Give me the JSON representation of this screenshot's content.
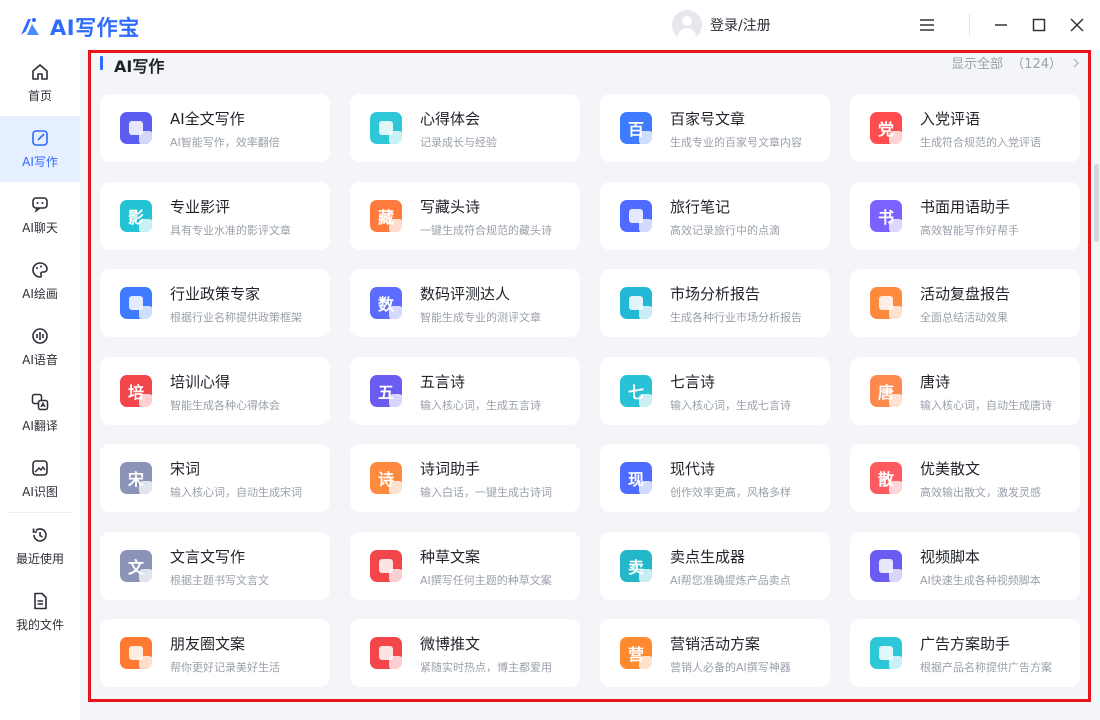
{
  "app": {
    "title": "AI写作宝"
  },
  "header": {
    "login_label": "登录/注册"
  },
  "sidebar": {
    "items": [
      {
        "label": "首页",
        "icon": "home-icon"
      },
      {
        "label": "AI写作",
        "icon": "edit-icon"
      },
      {
        "label": "AI聊天",
        "icon": "chat-icon"
      },
      {
        "label": "AI绘画",
        "icon": "palette-icon"
      },
      {
        "label": "AI语音",
        "icon": "voice-icon"
      },
      {
        "label": "AI翻译",
        "icon": "translate-icon"
      },
      {
        "label": "AI识图",
        "icon": "image-icon"
      },
      {
        "label": "最近使用",
        "icon": "history-icon"
      },
      {
        "label": "我的文件",
        "icon": "file-icon"
      }
    ]
  },
  "section": {
    "title": "AI写作",
    "show_all": "显示全部",
    "count": "（124）"
  },
  "cards": [
    {
      "title": "AI全文写作",
      "desc": "AI智能写作，效率翻倍",
      "color": "#5b5cf0",
      "glyph": ""
    },
    {
      "title": "心得体会",
      "desc": "记录成长与经验",
      "color": "#2ec7d8",
      "glyph": ""
    },
    {
      "title": "百家号文章",
      "desc": "生成专业的百家号文章内容",
      "color": "#3f7bff",
      "glyph": "百"
    },
    {
      "title": "入党评语",
      "desc": "生成符合规范的入党评语",
      "color": "#ff4d4f",
      "glyph": "党"
    },
    {
      "title": "专业影评",
      "desc": "具有专业水准的影评文章",
      "color": "#24c3d5",
      "glyph": "影"
    },
    {
      "title": "写藏头诗",
      "desc": "一键生成符合规范的藏头诗",
      "color": "#ff7a3d",
      "glyph": "藏"
    },
    {
      "title": "旅行笔记",
      "desc": "高效记录旅行中的点滴",
      "color": "#4f6bff",
      "glyph": ""
    },
    {
      "title": "书面用语助手",
      "desc": "高效智能写作好帮手",
      "color": "#7b61ff",
      "glyph": "书"
    },
    {
      "title": "行业政策专家",
      "desc": "根据行业名称提供政策框架",
      "color": "#3f7bff",
      "glyph": ""
    },
    {
      "title": "数码评测达人",
      "desc": "智能生成专业的测评文章",
      "color": "#5b6cff",
      "glyph": "数"
    },
    {
      "title": "市场分析报告",
      "desc": "生成各种行业市场分析报告",
      "color": "#22b8d6",
      "glyph": ""
    },
    {
      "title": "活动复盘报告",
      "desc": "全面总结活动效果",
      "color": "#ff8a3d",
      "glyph": ""
    },
    {
      "title": "培训心得",
      "desc": "智能生成各种心得体会",
      "color": "#f2464b",
      "glyph": "培"
    },
    {
      "title": "五言诗",
      "desc": "输入核心词，生成五言诗",
      "color": "#6a5cf0",
      "glyph": "五"
    },
    {
      "title": "七言诗",
      "desc": "输入核心词，生成七言诗",
      "color": "#28c1d6",
      "glyph": "七"
    },
    {
      "title": "唐诗",
      "desc": "输入核心词，自动生成唐诗",
      "color": "#ff8a50",
      "glyph": "唐"
    },
    {
      "title": "宋词",
      "desc": "输入核心词，自动生成宋词",
      "color": "#8b93b8",
      "glyph": "宋"
    },
    {
      "title": "诗词助手",
      "desc": "输入白话，一键生成古诗词",
      "color": "#ff8a3d",
      "glyph": "诗"
    },
    {
      "title": "现代诗",
      "desc": "创作效率更高，风格多样",
      "color": "#4f6bff",
      "glyph": "现"
    },
    {
      "title": "优美散文",
      "desc": "高效输出散文，激发灵感",
      "color": "#ff5a5f",
      "glyph": "散"
    },
    {
      "title": "文言文写作",
      "desc": "根据主题书写文言文",
      "color": "#8b93b8",
      "glyph": "文"
    },
    {
      "title": "种草文案",
      "desc": "AI撰写任何主题的种草文案",
      "color": "#f2464b",
      "glyph": ""
    },
    {
      "title": "卖点生成器",
      "desc": "AI帮您准确提炼产品卖点",
      "color": "#22b8c9",
      "glyph": "卖"
    },
    {
      "title": "视频脚本",
      "desc": "AI快速生成各种视频脚本",
      "color": "#6a5cf0",
      "glyph": ""
    },
    {
      "title": "朋友圈文案",
      "desc": "帮你更好记录美好生活",
      "color": "#ff7a30",
      "glyph": ""
    },
    {
      "title": "微博推文",
      "desc": "紧随实时热点，博主都爱用",
      "color": "#f2464b",
      "glyph": ""
    },
    {
      "title": "营销活动方案",
      "desc": "营销人必备的AI撰写神器",
      "color": "#ff8a30",
      "glyph": "营"
    },
    {
      "title": "广告方案助手",
      "desc": "根据产品名称提供广告方案",
      "color": "#2ec7d8",
      "glyph": ""
    }
  ]
}
